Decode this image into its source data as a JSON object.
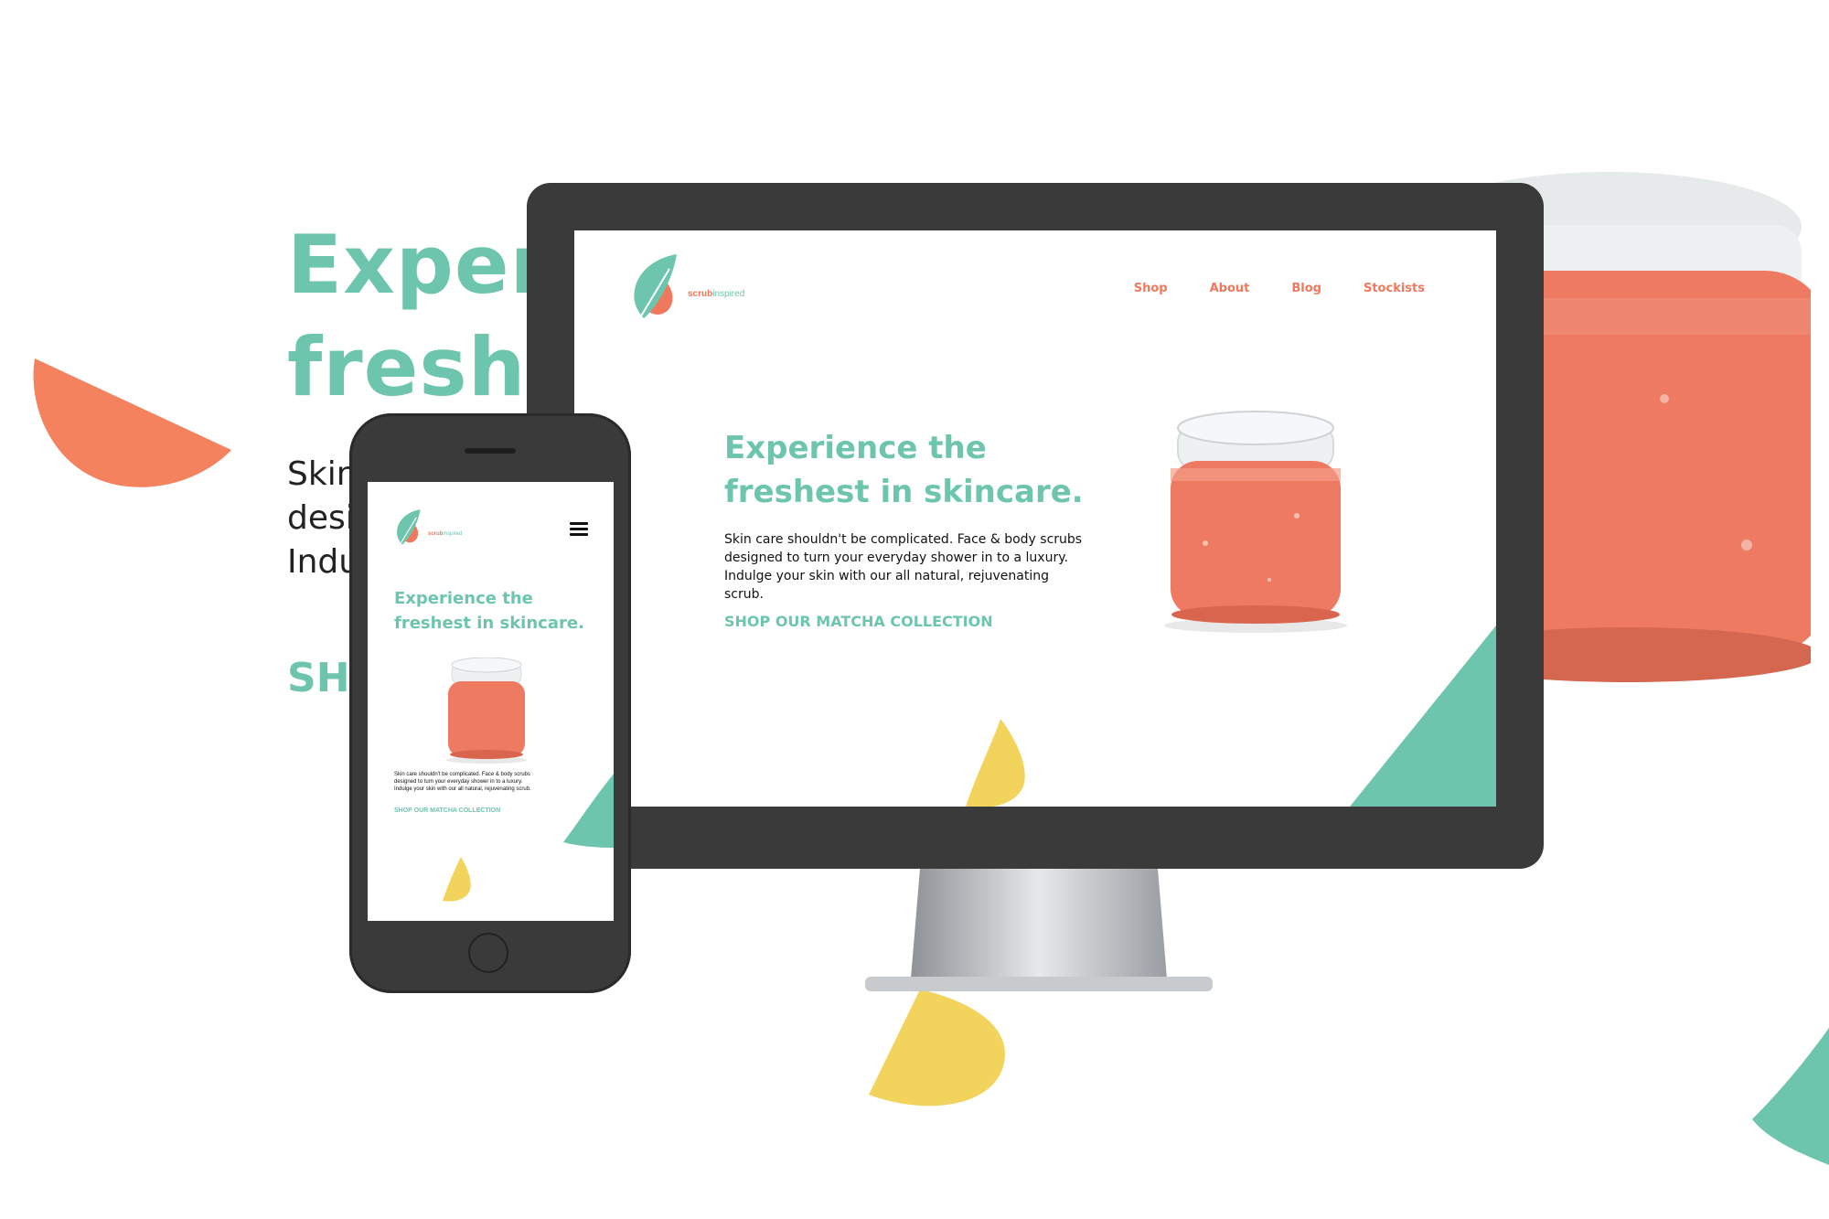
{
  "background": {
    "headline_line1": "Experie",
    "headline_line2": "freshes",
    "body_line1": "Skin",
    "body_line2": "desig",
    "body_line3": "Indu",
    "cta": "SHO"
  },
  "desktop": {
    "brand_bold": "scrub",
    "brand_light": "inspired",
    "nav": [
      "Shop",
      "About",
      "Blog",
      "Stockists"
    ],
    "headline_line1": "Experience the",
    "headline_line2": "freshest in skincare.",
    "body_line1": "Skin care shouldn't be complicated. Face & body scrubs",
    "body_line2": "designed to turn your everyday shower in to a luxury.",
    "body_line3": "Indulge your skin with our all natural, rejuvenating scrub.",
    "cta": "SHOP OUR MATCHA COLLECTION"
  },
  "mobile": {
    "brand_bold": "scrub",
    "brand_light": "inspired",
    "headline_line1": "Experience the",
    "headline_line2": "freshest in skincare.",
    "body_line1": "Skin care shouldn't be complicated. Face & body scrubs",
    "body_line2": "designed to turn your everyday shower in to a luxury.",
    "body_line3": "Indulge your skin with our all natural, rejuvenating scrub.",
    "cta": "SHOP OUR MATCHA COLLECTION"
  },
  "colors": {
    "green": "#6dc5ad",
    "coral": "#f0785c",
    "yellow": "#f2d45c",
    "device": "#3a3a3a"
  },
  "icons": {
    "logo": "leaf-logo-icon",
    "menu": "hamburger-menu-icon"
  }
}
